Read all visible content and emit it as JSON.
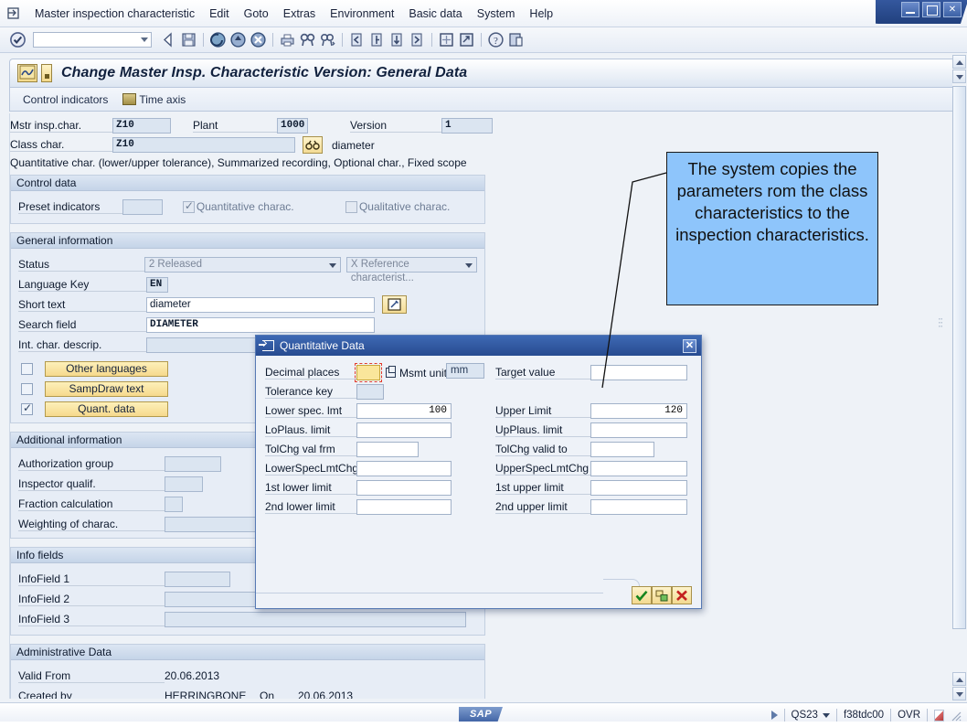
{
  "window": {
    "controls": [
      "minimize",
      "maximize",
      "close"
    ]
  },
  "menubar": {
    "system_icon": "command-field-icon",
    "items": [
      "Master inspection characteristic",
      "Edit",
      "Goto",
      "Extras",
      "Environment",
      "Basic data",
      "System",
      "Help"
    ]
  },
  "toolbar": {
    "enter_icon": "check-circle-icon",
    "command_field_value": "",
    "icons": [
      "back-arrow-icon",
      "save-disk-icon",
      "back-green-icon",
      "exit-yellow-icon",
      "cancel-red-icon",
      "print-icon",
      "find-icon",
      "find-next-icon",
      "first-page-icon",
      "previous-page-icon",
      "next-page-icon",
      "last-page-icon",
      "new-session-icon",
      "create-shortcut-icon",
      "help-icon",
      "customize-local-layout-icon"
    ]
  },
  "screen": {
    "title": "Change Master Insp. Characteristic Version: General Data",
    "title_icon": "sap-screen-icon",
    "tabbar": [
      {
        "label": "Control indicators",
        "icon": ""
      },
      {
        "label": "Time axis",
        "icon": "time-axis-icon"
      }
    ]
  },
  "header_fields": {
    "mstr_insp_char_label": "Mstr insp.char.",
    "mstr_insp_char_value": "Z10",
    "plant_label": "Plant",
    "plant_value": "1000",
    "version_label": "Version",
    "version_value": "1",
    "class_char_label": "Class char.",
    "class_char_value": "Z10",
    "class_char_icon": "binoculars-icon",
    "class_char_desc": "diameter",
    "summary_line": "Quantitative char. (lower/upper tolerance), Summarized recording, Optional char., Fixed scope"
  },
  "control_data": {
    "title": "Control data",
    "preset_indicators_label": "Preset indicators",
    "preset_indicators_value": "",
    "quantitative_label": "Quantitative charac.",
    "quantitative_checked": true,
    "qualitative_label": "Qualitative charac.",
    "qualitative_checked": false
  },
  "general_information": {
    "title": "General information",
    "status_label": "Status",
    "status_value": "2 Released",
    "reference_value": "X Reference characterist...",
    "language_key_label": "Language Key",
    "language_key_value": "EN",
    "short_text_label": "Short text",
    "short_text_value": "diameter",
    "short_text_edit_icon": "edit-pencil-icon",
    "search_field_label": "Search field",
    "search_field_value": "DIAMETER",
    "int_char_descrip_label": "Int. char. descrip.",
    "int_char_descrip_value": "",
    "buttons": [
      {
        "label": "Other languages",
        "checked": false
      },
      {
        "label": "SampDraw text",
        "checked": false
      },
      {
        "label": "Quant. data",
        "checked": true
      }
    ]
  },
  "additional_information": {
    "title": "Additional information",
    "rows": [
      {
        "label": "Authorization group",
        "value": ""
      },
      {
        "label": "Inspector qualif.",
        "value": ""
      },
      {
        "label": "Fraction calculation",
        "value": ""
      },
      {
        "label": "Weighting of charac.",
        "value": ""
      }
    ]
  },
  "info_fields": {
    "title": "Info fields",
    "rows": [
      {
        "label": "InfoField 1",
        "value": ""
      },
      {
        "label": "InfoField 2",
        "value": ""
      },
      {
        "label": "InfoField 3",
        "value": ""
      }
    ]
  },
  "administrative_data": {
    "title": "Administrative Data",
    "valid_from_label": "Valid From",
    "valid_from_value": "20.06.2013",
    "created_by_label": "Created by",
    "created_by_value": "HERRINGBONE",
    "on_label": "On",
    "on_value": "20.06.2013"
  },
  "dialog": {
    "title": "Quantitative Data",
    "title_icon": "dialog-icon",
    "close_icon": "close-icon",
    "left": [
      {
        "label": "Decimal places",
        "value": "",
        "highlight": true
      },
      {
        "label": "Tolerance key",
        "value": ""
      },
      {
        "label": "Lower spec. lmt",
        "value": "100"
      },
      {
        "label": "LoPlaus. limit",
        "value": ""
      },
      {
        "label": "TolChg val frm",
        "value": ""
      },
      {
        "label": "LowerSpecLmtChg",
        "value": ""
      },
      {
        "label": "1st lower limit",
        "value": ""
      },
      {
        "label": "2nd lower limit",
        "value": ""
      }
    ],
    "msmt_unit_label": "Msmt unit",
    "msmt_unit_value": "mm",
    "msmt_unit_icon": "value-help-icon",
    "right": [
      {
        "label": "Target value",
        "value": ""
      },
      {
        "label": "Upper Limit",
        "value": "120"
      },
      {
        "label": "UpPlaus. limit",
        "value": ""
      },
      {
        "label": "TolChg valid to",
        "value": ""
      },
      {
        "label": "UpperSpecLmtChg",
        "value": ""
      },
      {
        "label": "1st upper limit",
        "value": ""
      },
      {
        "label": "2nd upper limit",
        "value": ""
      }
    ],
    "footer_buttons": [
      {
        "icon": "green-check-continue-icon",
        "glyph": "✔"
      },
      {
        "icon": "copy-transfer-icon",
        "glyph": "⧉"
      },
      {
        "icon": "red-cancel-icon",
        "glyph": "✖"
      }
    ]
  },
  "callout": {
    "text": "The system copies the parameters rom the class characteristics to the inspection characteristics.",
    "bg_color": "#8ec5fb",
    "border_color": "#1b1b1b"
  },
  "statusbar": {
    "logo": "SAP",
    "play_icon": "expand-arrow-icon",
    "system": "QS23",
    "server": "f38tdc00",
    "insert_mode": "OVR",
    "grip_icon": "resize-grip-icon"
  }
}
